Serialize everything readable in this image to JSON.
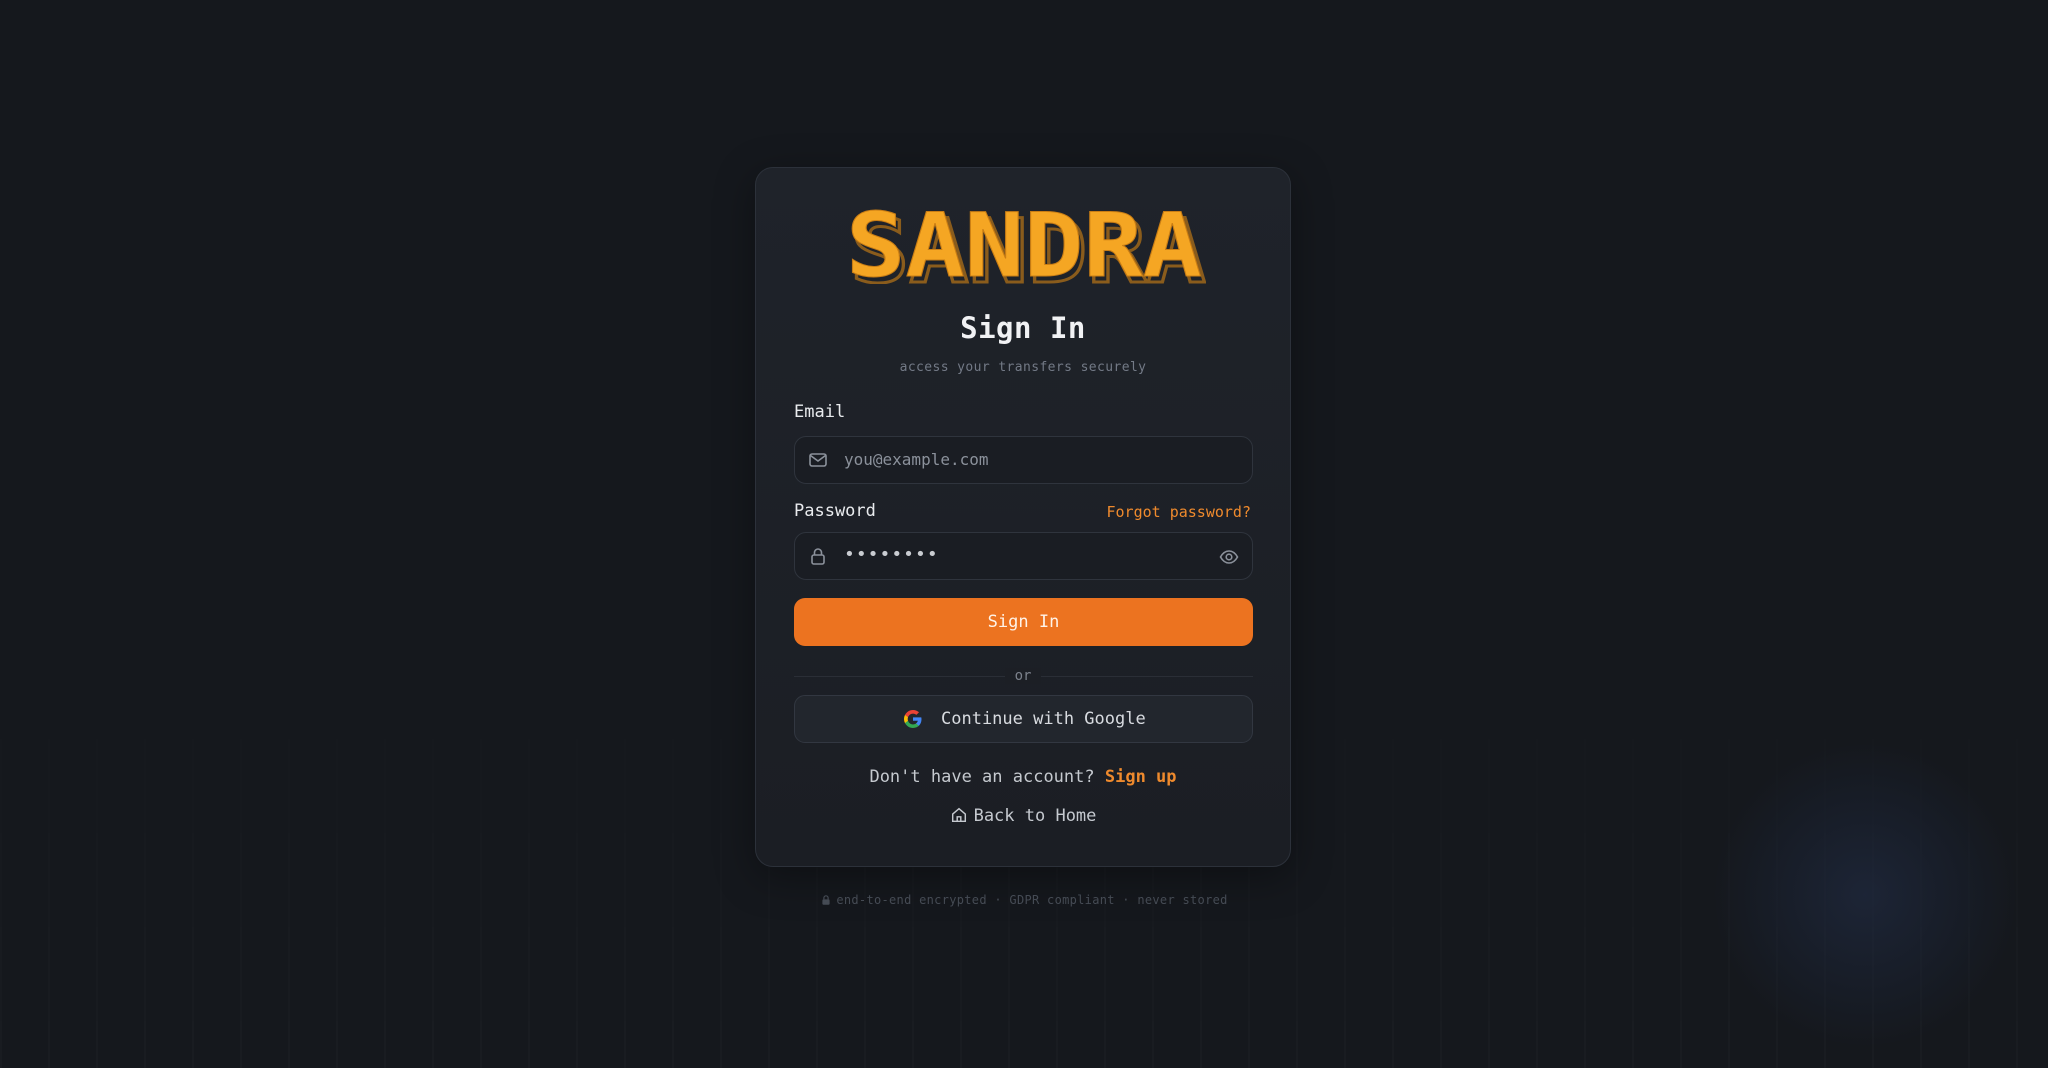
{
  "brand": {
    "logo_text": "SANDRA"
  },
  "signin": {
    "title": "Sign In",
    "subtitle": "access your transfers securely"
  },
  "email": {
    "label": "Email",
    "placeholder": "you@example.com",
    "icon": "mail-icon"
  },
  "password": {
    "label": "Password",
    "forgot_label": "Forgot password?",
    "masked_value": "••••••••",
    "icon": "lock-icon",
    "toggle_icon": "eye-icon"
  },
  "actions": {
    "submit_label": "Sign In",
    "divider_label": "or",
    "google_label": "Continue with Google"
  },
  "signup": {
    "prompt": "Don't have an account?",
    "link_label": "Sign up"
  },
  "home": {
    "label": "Back to Home",
    "icon": "home-icon"
  },
  "footer": {
    "text": "end-to-end encrypted · GDPR compliant · never stored"
  },
  "colors": {
    "accent": "#ec7320",
    "accent_text": "#ef8a2d",
    "logo_fill": "#f5a623",
    "background": "#15181d",
    "card": "#1f232a"
  }
}
